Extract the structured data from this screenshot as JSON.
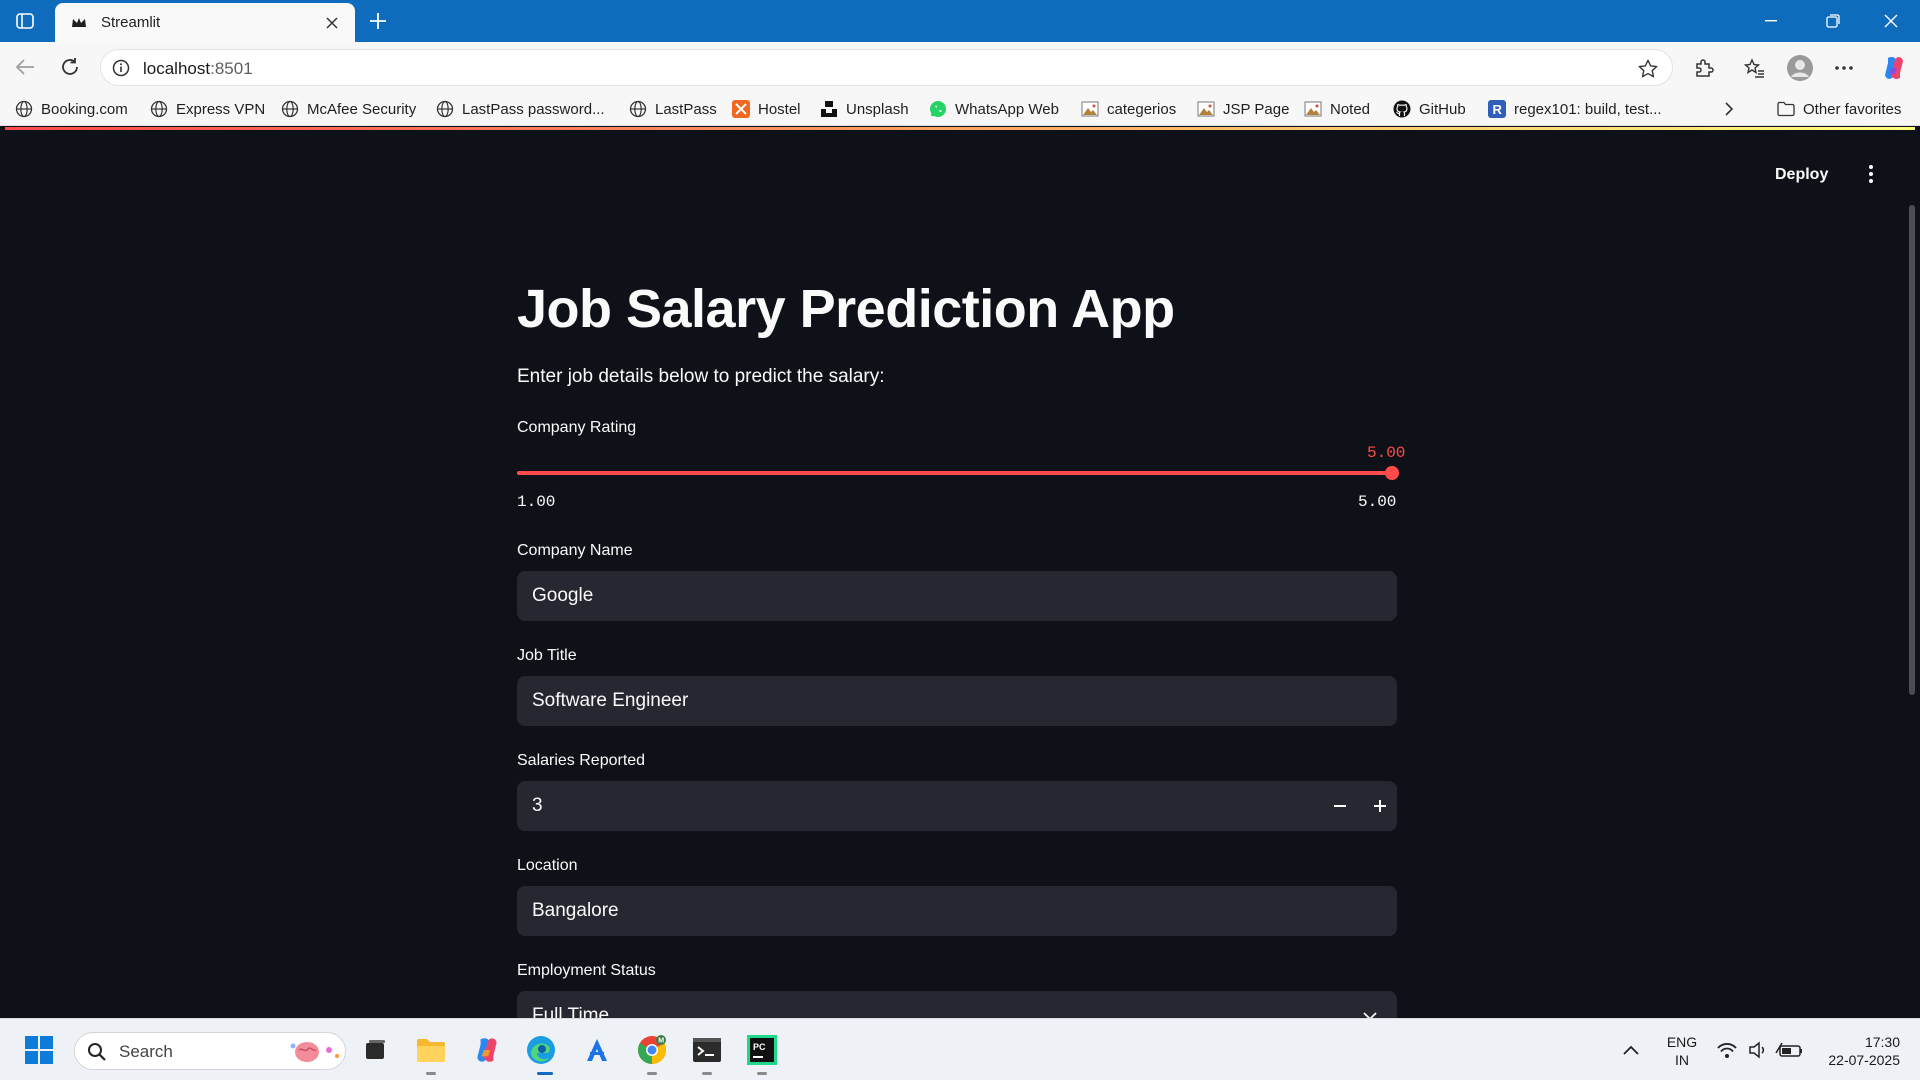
{
  "browser": {
    "tab_title": "Streamlit",
    "address": "localhost",
    "address_port": ":8501",
    "bookmarks": [
      {
        "label": "Booking.com",
        "icon": "globe-icon"
      },
      {
        "label": "Express VPN",
        "icon": "globe-icon"
      },
      {
        "label": "McAfee Security",
        "icon": "globe-icon"
      },
      {
        "label": "LastPass password...",
        "icon": "globe-icon"
      },
      {
        "label": "LastPass",
        "icon": "globe-icon"
      },
      {
        "label": "Hostel",
        "icon": "hostel-icon"
      },
      {
        "label": "Unsplash",
        "icon": "unsplash-icon"
      },
      {
        "label": "WhatsApp Web",
        "icon": "whatsapp-icon"
      },
      {
        "label": "categerios",
        "icon": "image-icon"
      },
      {
        "label": "JSP Page",
        "icon": "image-icon"
      },
      {
        "label": "Noted",
        "icon": "image-icon"
      },
      {
        "label": "GitHub",
        "icon": "github-icon"
      },
      {
        "label": "regex101: build, test...",
        "icon": "regex-icon"
      }
    ],
    "other_favorites": "Other favorites"
  },
  "app": {
    "deploy_label": "Deploy",
    "title": "Job Salary Prediction App",
    "subtitle": "Enter job details below to predict the salary:",
    "rating": {
      "label": "Company Rating",
      "value": "5.00",
      "min": "1.00",
      "max": "5.00",
      "fraction": 1.0
    },
    "company_name": {
      "label": "Company Name",
      "value": "Google"
    },
    "job_title": {
      "label": "Job Title",
      "value": "Software Engineer"
    },
    "salaries_reported": {
      "label": "Salaries Reported",
      "value": "3"
    },
    "location": {
      "label": "Location",
      "value": "Bangalore"
    },
    "employment_status": {
      "label": "Employment Status",
      "value": "Full Time"
    },
    "accent_color": "#ff4b4b"
  },
  "taskbar": {
    "search_placeholder": "Search",
    "language": "ENG",
    "region": "IN",
    "time": "17:30",
    "date": "22-07-2025"
  }
}
